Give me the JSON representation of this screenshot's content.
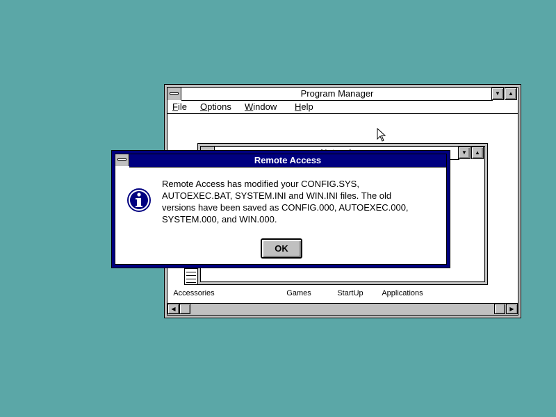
{
  "program_manager": {
    "title": "Program Manager",
    "menu": {
      "file": "File",
      "options": "Options",
      "window": "Window",
      "help": "Help"
    },
    "group_icons": [
      {
        "label": "Accessories"
      },
      {
        "label": "Games"
      },
      {
        "label": "StartUp"
      },
      {
        "label": "Applications"
      }
    ]
  },
  "network_group": {
    "title": "Network"
  },
  "dialog": {
    "title": "Remote Access",
    "message": "Remote Access has modified your CONFIG.SYS,\nAUTOEXEC.BAT, SYSTEM.INI and WIN.INI files. The old\nversions have been saved as CONFIG.000, AUTOEXEC.000,\nSYSTEM.000, and WIN.000.",
    "ok_label": "OK",
    "icon": "information-icon"
  },
  "colors": {
    "desktop": "#5ba7a7",
    "active_title": "#000080",
    "face": "#c0c0c0"
  }
}
